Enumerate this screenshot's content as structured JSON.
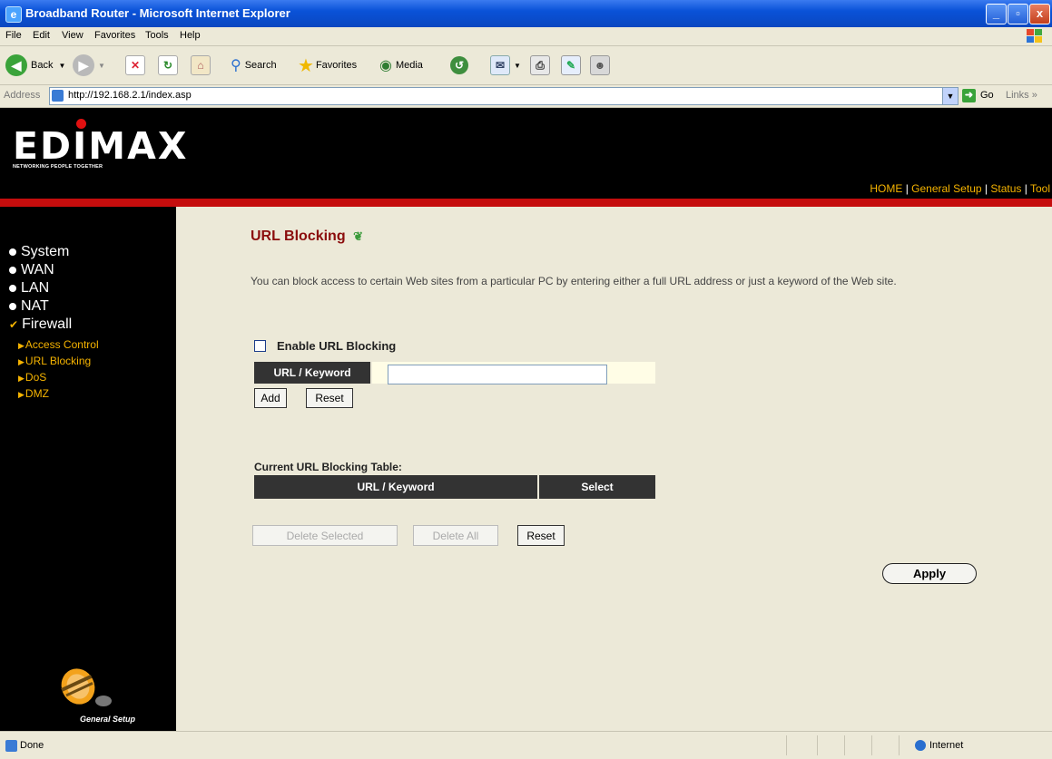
{
  "window": {
    "title": "Broadband Router - Microsoft Internet Explorer",
    "minimize": "_",
    "maximize": "▫",
    "close": "x"
  },
  "menu": [
    "File",
    "Edit",
    "View",
    "Favorites",
    "Tools",
    "Help"
  ],
  "toolbar": {
    "back": "Back",
    "search": "Search",
    "favorites": "Favorites",
    "media": "Media"
  },
  "address": {
    "label": "Address",
    "url": "http://192.168.2.1/index.asp",
    "go": "Go",
    "links": "Links »"
  },
  "header": {
    "logo": "EDIMAX",
    "tagline": "NETWORKING PEOPLE TOGETHER",
    "nav": [
      "HOME",
      "General Setup",
      "Status",
      "Tool"
    ],
    "sep": "|"
  },
  "sidebar": {
    "items": [
      "System",
      "WAN",
      "LAN",
      "NAT",
      "Firewall"
    ],
    "subitems": [
      "Access Control",
      "URL Blocking",
      "DoS",
      "DMZ"
    ],
    "footer_label": "General Setup"
  },
  "main": {
    "title": "URL Blocking",
    "description": "You can block access to certain Web sites from a particular PC by entering either a full URL address or just a keyword of the Web site.",
    "enable_label": "Enable URL Blocking",
    "enable_checked": false,
    "keyword_label": "URL / Keyword",
    "keyword_value": "",
    "add_button": "Add",
    "reset_button": "Reset",
    "table_label": "Current URL Blocking Table:",
    "table_columns": [
      "URL / Keyword",
      "Select"
    ],
    "delete_selected": "Delete Selected",
    "delete_all": "Delete All",
    "table_reset": "Reset",
    "apply": "Apply"
  },
  "status": {
    "text": "Done",
    "zone": "Internet"
  },
  "colors": {
    "header_bg": "#000000",
    "accent_red": "#c50d0d",
    "nav_gold": "#f5b300",
    "title_red": "#8b0d0d",
    "content_bg": "#ece9d8",
    "table_header": "#333333"
  }
}
